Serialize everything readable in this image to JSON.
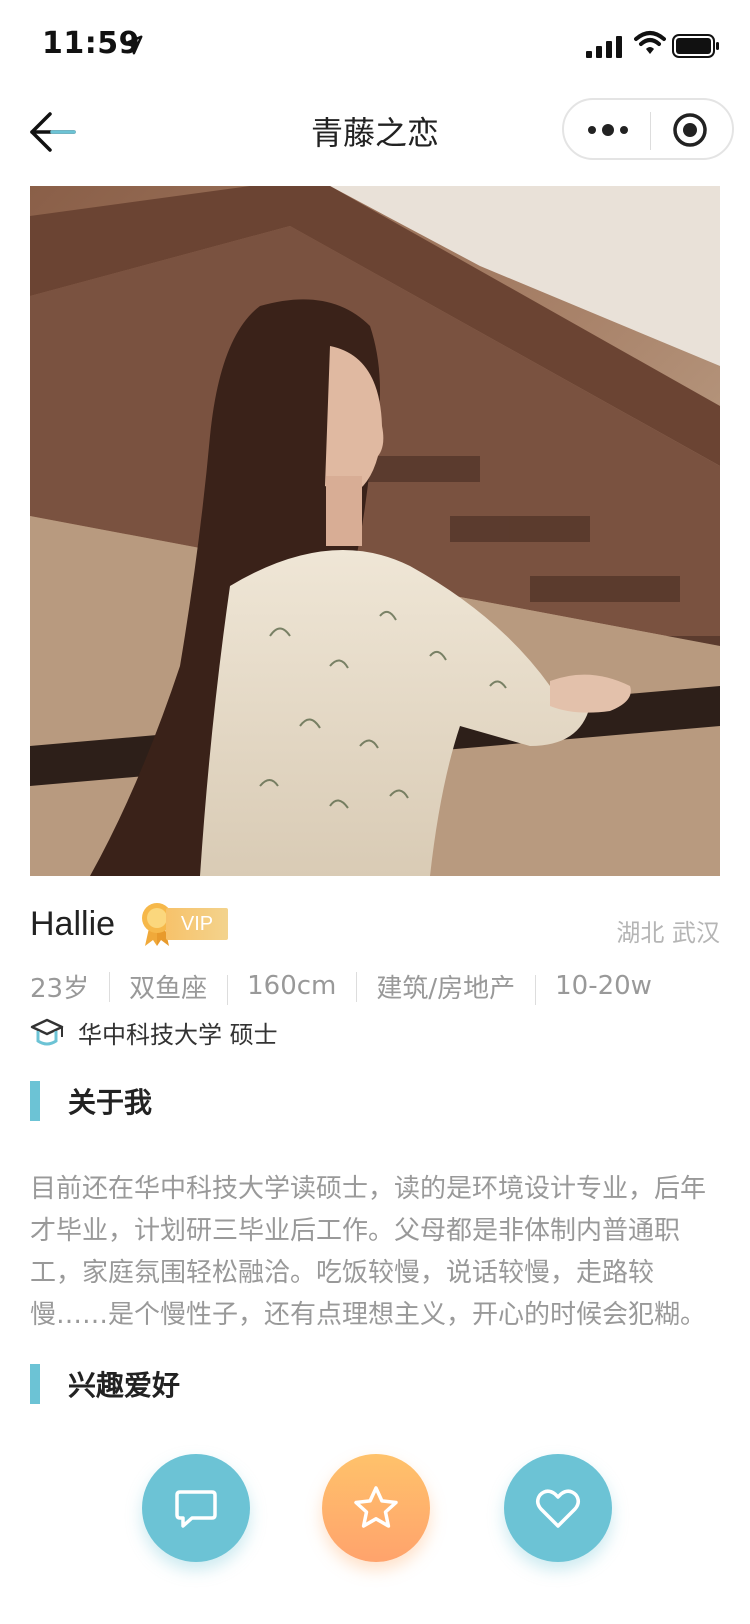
{
  "status_bar": {
    "time": "11:59"
  },
  "nav": {
    "title": "青藤之恋"
  },
  "profile": {
    "name": "Hallie",
    "vip_label": "VIP",
    "location": "湖北 武汉",
    "attributes": [
      "23岁",
      "双鱼座",
      "160cm",
      "建筑/房地产",
      "10-20w"
    ],
    "education": "华中科技大学 硕士"
  },
  "sections": {
    "about": {
      "title": "关于我",
      "text": "目前还在华中科技大学读硕士，读的是环境设计专业，后年才毕业，计划研三毕业后工作。父母都是非体制内普通职工，家庭氛围轻松融洽。吃饭较慢，说话较慢，走路较慢……是个慢性子，还有点理想主义，开心的时候会犯糊。"
    },
    "hobbies": {
      "title": "兴趣爱好"
    }
  },
  "colors": {
    "accent": "#6cc3d5",
    "star_button": "#ffb26b",
    "vip": "#f7c26a"
  },
  "icons": {
    "back": "arrow-left-icon",
    "more": "more-dots-icon",
    "close": "target-circle-icon",
    "education": "graduation-cap-icon",
    "chat": "chat-bubble-icon",
    "star": "star-icon",
    "like": "heart-icon"
  }
}
